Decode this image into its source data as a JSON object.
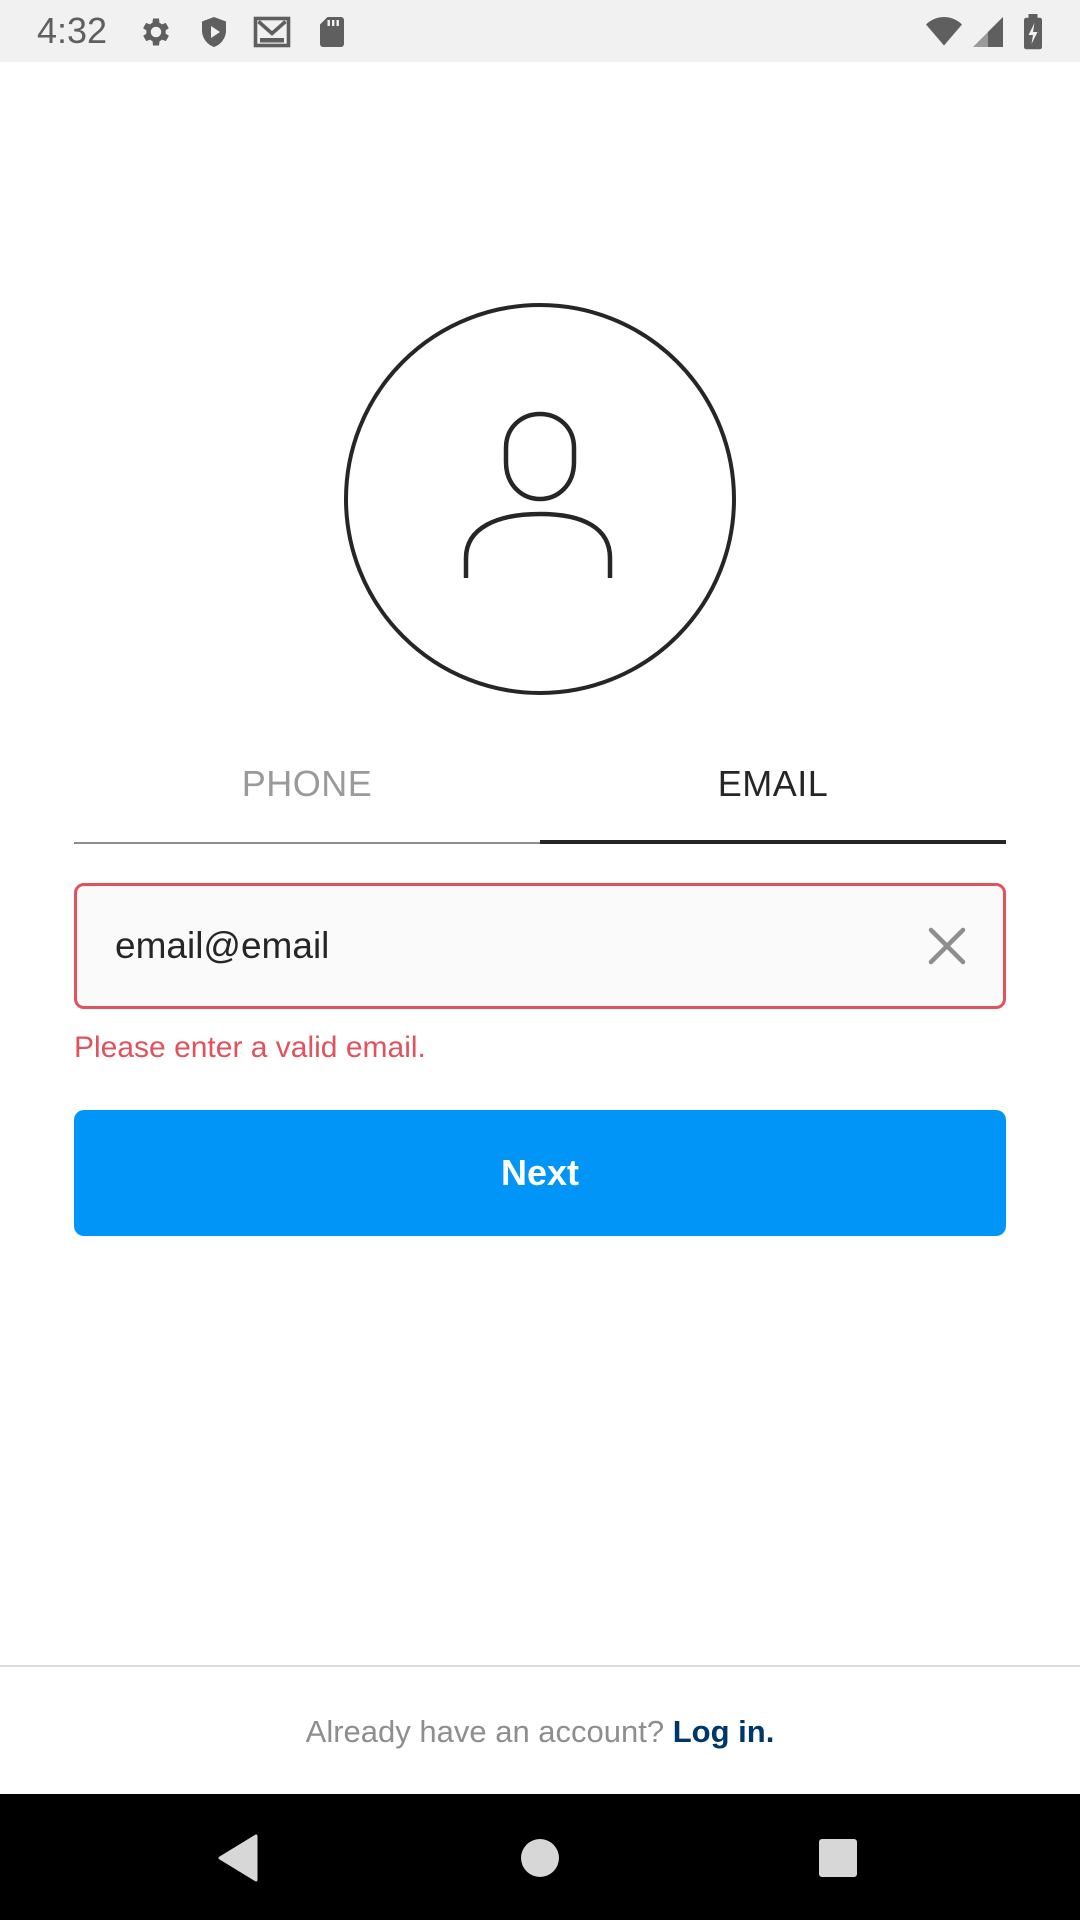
{
  "status_bar": {
    "time": "4:32",
    "icons": [
      "gear-icon",
      "shield-play-icon",
      "mail-icon",
      "sd-card-icon",
      "wifi-icon",
      "cell-signal-icon",
      "battery-charging-icon"
    ]
  },
  "avatar": {
    "icon": "person-icon"
  },
  "tabs": {
    "phone_label": "PHONE",
    "email_label": "EMAIL",
    "selected": "EMAIL"
  },
  "email_input": {
    "value": "email@email",
    "clear_icon": "close-icon"
  },
  "error": {
    "message": "Please enter a valid email."
  },
  "next_button": {
    "label": "Next"
  },
  "footer": {
    "prompt": "Already have an account? ",
    "link": "Log in."
  },
  "nav_bar": {
    "icons": [
      "back-icon",
      "home-icon",
      "recents-icon"
    ]
  },
  "colors": {
    "accent": "#0095f6",
    "error": "#e0535d",
    "link": "#00376b"
  }
}
